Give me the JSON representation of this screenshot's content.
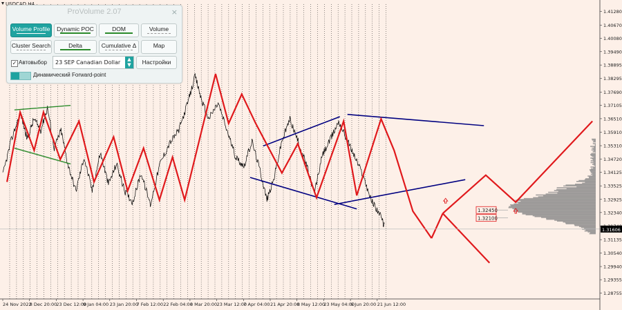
{
  "symbol_label": "USDCAD,H4",
  "panel": {
    "title": "ProVolume 2.07",
    "close": "×",
    "buttons": [
      "Volume Profile",
      "Dynamic POC",
      "DOM",
      "Volume",
      "Cluster Search",
      "Delta",
      "Cumulative Δ",
      "Map"
    ],
    "auto_checkbox_mark": "✓",
    "auto_label": "Автовыбор",
    "instrument": "23 SEP Canadian Dollar",
    "settings_label": "Настройки",
    "forward_label": "Динамический Forward-point"
  },
  "colors": {
    "background": "#fdf0e8",
    "price": "#000000",
    "zigzag": "#e0191c",
    "channel": "#000080",
    "green_line": "#2a8a2a",
    "accent": "#1fa3a0"
  },
  "chart_data": {
    "type": "line",
    "ylim": [
      1.285,
      1.416
    ],
    "y_ticks": [
      "1.41280",
      "1.40670",
      "1.40080",
      "1.39490",
      "1.38895",
      "1.38295",
      "1.37690",
      "1.37105",
      "1.36510",
      "1.35910",
      "1.35310",
      "1.34720",
      "1.34125",
      "1.33525",
      "1.32925",
      "1.32340",
      "1.31740",
      "1.31135",
      "1.30540",
      "1.29940",
      "1.29355",
      "1.28755"
    ],
    "x_labels": [
      "24 Nov 2022",
      "8 Dec 20:00",
      "23 Dec 12:00",
      "9 Jan 04:00",
      "23 Jan 20:00",
      "7 Feb 12:00",
      "22 Feb 04:00",
      "8 Mar 20:00",
      "23 Mar 12:00",
      "7 Apr 04:00",
      "21 Apr 20:00",
      "8 May 12:00",
      "23 May 04:00",
      "6 Jun 20:00",
      "21 Jun 12:00"
    ],
    "price_anchors": [
      [
        0,
        1.34
      ],
      [
        0.03,
        1.355
      ],
      [
        0.065,
        1.368
      ],
      [
        0.09,
        1.356
      ],
      [
        0.115,
        1.365
      ],
      [
        0.14,
        1.36
      ],
      [
        0.165,
        1.37
      ],
      [
        0.19,
        1.352
      ],
      [
        0.215,
        1.36
      ],
      [
        0.24,
        1.345
      ],
      [
        0.27,
        1.333
      ],
      [
        0.3,
        1.348
      ],
      [
        0.33,
        1.333
      ],
      [
        0.36,
        1.35
      ],
      [
        0.39,
        1.336
      ],
      [
        0.42,
        1.345
      ],
      [
        0.45,
        1.333
      ],
      [
        0.48,
        1.328
      ],
      [
        0.51,
        1.341
      ],
      [
        0.545,
        1.327
      ],
      [
        0.58,
        1.345
      ],
      [
        0.615,
        1.354
      ],
      [
        0.65,
        1.36
      ],
      [
        0.685,
        1.373
      ],
      [
        0.71,
        1.384
      ],
      [
        0.735,
        1.373
      ],
      [
        0.76,
        1.365
      ],
      [
        0.795,
        1.372
      ],
      [
        0.83,
        1.359
      ],
      [
        0.86,
        1.348
      ],
      [
        0.89,
        1.344
      ],
      [
        0.92,
        1.355
      ],
      [
        0.95,
        1.342
      ],
      [
        0.975,
        1.329
      ],
      [
        1.0,
        1.338
      ],
      [
        1.03,
        1.355
      ],
      [
        1.06,
        1.365
      ],
      [
        1.09,
        1.355
      ],
      [
        1.12,
        1.345
      ],
      [
        1.15,
        1.332
      ],
      [
        1.18,
        1.349
      ],
      [
        1.21,
        1.356
      ],
      [
        1.24,
        1.364
      ],
      [
        1.27,
        1.356
      ],
      [
        1.3,
        1.348
      ],
      [
        1.33,
        1.34
      ],
      [
        1.36,
        1.329
      ],
      [
        1.39,
        1.323
      ],
      [
        1.41,
        1.317
      ]
    ],
    "zigzag": [
      [
        1.359,
        1.337
      ],
      [
        1.366,
        1.368
      ],
      [
        1.3735,
        1.351
      ],
      [
        1.3785,
        1.368
      ],
      [
        1.3875,
        1.347
      ],
      [
        1.3975,
        1.364
      ],
      [
        1.4055,
        1.337
      ],
      [
        1.416,
        1.357
      ],
      [
        1.4235,
        1.333
      ],
      [
        1.432,
        1.352
      ],
      [
        1.4405,
        1.329
      ],
      [
        1.4475,
        1.348
      ],
      [
        1.454,
        1.329
      ],
      [
        1.4705,
        1.385
      ],
      [
        1.4775,
        1.363
      ],
      [
        1.4845,
        1.376
      ],
      [
        1.492,
        1.363
      ],
      [
        1.506,
        1.341
      ],
      [
        1.5145,
        1.354
      ],
      [
        1.5245,
        1.33
      ],
      [
        1.539,
        1.364
      ],
      [
        1.546,
        1.331
      ],
      [
        1.559,
        1.365
      ],
      [
        1.566,
        1.351
      ],
      [
        1.576,
        1.324
      ],
      [
        1.586,
        1.312
      ]
    ],
    "zigzag_projection": [
      [
        1.586,
        1.312
      ],
      [
        1.592,
        1.323
      ]
    ],
    "zigzag_projection_up": [
      [
        1.592,
        1.323
      ],
      [
        1.615,
        1.34
      ],
      [
        1.631,
        1.328
      ],
      [
        1.672,
        1.364
      ]
    ],
    "zigzag_projection_down": [
      [
        1.592,
        1.323
      ],
      [
        1.617,
        1.301
      ]
    ],
    "channels": [
      [
        [
          1.496,
          1.353
        ],
        [
          1.537,
          1.366
        ]
      ],
      [
        [
          1.489,
          1.339
        ],
        [
          1.546,
          1.325
        ]
      ],
      [
        [
          1.534,
          1.327
        ],
        [
          1.604,
          1.338
        ]
      ],
      [
        [
          1.541,
          1.367
        ],
        [
          1.614,
          1.362
        ]
      ]
    ],
    "channel_lines_green": [
      [
        [
          1.363,
          1.369
        ],
        [
          1.393,
          1.371
        ]
      ],
      [
        [
          1.363,
          1.352
        ],
        [
          1.393,
          1.345
        ]
      ]
    ],
    "volume_profile_peak": 1.3253,
    "price_levels": [
      {
        "label": "1.32450",
        "price": 1.3245
      },
      {
        "label": "1.32100",
        "price": 1.321
      }
    ],
    "current_price": {
      "label": "1.31606",
      "value": 1.31606
    },
    "arrows_up": [
      [
        1.5935,
        1.3285
      ],
      [
        1.631,
        1.324
      ]
    ]
  }
}
